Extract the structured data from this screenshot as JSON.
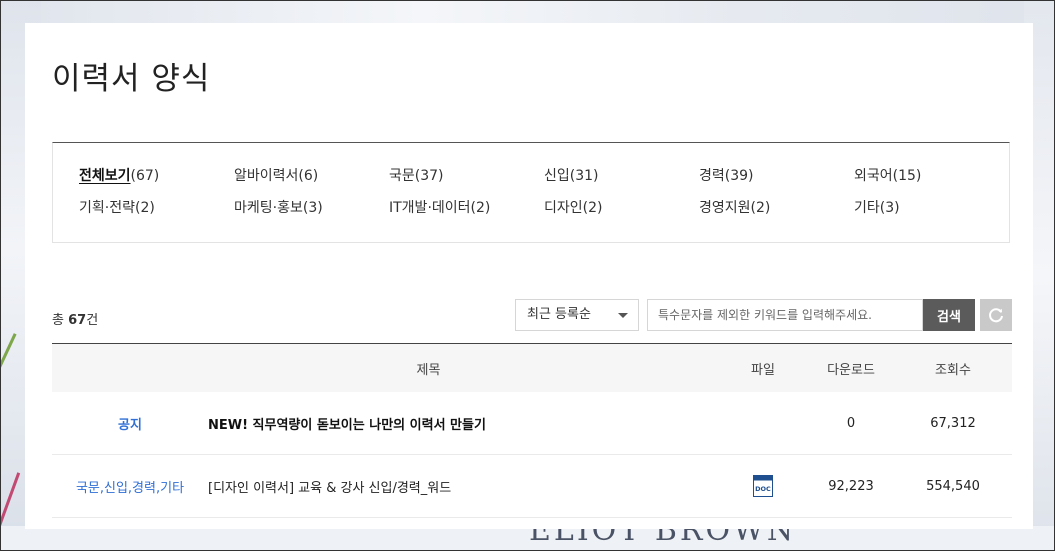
{
  "background": {
    "brand_text": "ELIOT BROWN"
  },
  "page": {
    "title": "이력서 양식"
  },
  "categories": [
    {
      "label": "전체보기",
      "count": "(67)",
      "active": true
    },
    {
      "label": "알바이력서",
      "count": "(6)"
    },
    {
      "label": "국문",
      "count": "(37)"
    },
    {
      "label": "신입",
      "count": "(31)"
    },
    {
      "label": "경력",
      "count": "(39)"
    },
    {
      "label": "외국어",
      "count": "(15)"
    },
    {
      "label": "기획·전략",
      "count": "(2)"
    },
    {
      "label": "마케팅·홍보",
      "count": "(3)"
    },
    {
      "label": "IT개발·데이터",
      "count": "(2)"
    },
    {
      "label": "디자인",
      "count": "(2)"
    },
    {
      "label": "경영지원",
      "count": "(2)"
    },
    {
      "label": "기타",
      "count": "(3)"
    }
  ],
  "summary": {
    "prefix": "총",
    "count": "67",
    "suffix": "건"
  },
  "toolbar": {
    "sort_selected": "최근 등록순",
    "search_placeholder": "특수문자를 제외한 키워드를 입력해주세요.",
    "search_label": "검색",
    "reset_icon": "refresh-icon"
  },
  "table": {
    "headers": {
      "category": "",
      "title": "제목",
      "file": "파일",
      "downloads": "다운로드",
      "views": "조회수"
    },
    "rows": [
      {
        "category": "공지",
        "title": "NEW! 직무역량이 돋보이는 나만의 이력서 만들기",
        "file": "",
        "downloads": "0",
        "views": "67,312",
        "notice": true
      },
      {
        "category": "국문,신입,경력,기타",
        "title": "[디자인 이력서] 교육 & 강사 신입/경력_워드",
        "file": "DOC",
        "downloads": "92,223",
        "views": "554,540"
      }
    ]
  },
  "colors": {
    "accent_blue": "#2f6fd6",
    "search_button": "#5b5b5b",
    "reset_button": "#c9c9c9",
    "doc_icon": "#1f4f8f"
  }
}
